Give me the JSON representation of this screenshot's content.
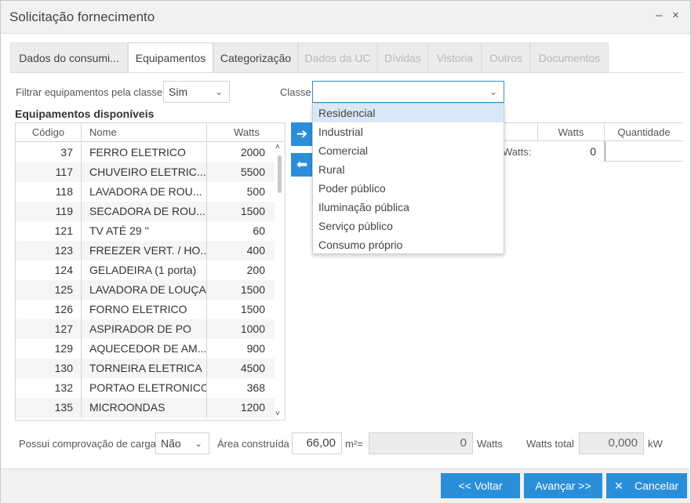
{
  "window": {
    "title": "Solicitação fornecimento",
    "minimize": "–",
    "close": "×"
  },
  "tabs": [
    {
      "label": "Dados do consumi..."
    },
    {
      "label": "Equipamentos"
    },
    {
      "label": "Categorização"
    },
    {
      "label": "Dados da UC"
    },
    {
      "label": "Dívidas"
    },
    {
      "label": "Vistoria"
    },
    {
      "label": "Outros"
    },
    {
      "label": "Documentos"
    }
  ],
  "filter": {
    "label": "Filtrar equipamentos pela classe",
    "value": "Sim",
    "chevron": "⌄"
  },
  "classe": {
    "label": "Classe",
    "value": "",
    "chevron": "⌄",
    "options": [
      "Residencial",
      "Industrial",
      "Comercial",
      "Rural",
      "Poder público",
      "Iluminação pública",
      "Serviço público",
      "Consumo próprio"
    ]
  },
  "available": {
    "title": "Equipamentos disponíveis",
    "headers": {
      "code": "Código",
      "name": "Nome",
      "watts": "Watts"
    },
    "rows": [
      {
        "code": "37",
        "name": "FERRO ELETRICO",
        "watts": "2000"
      },
      {
        "code": "117",
        "name": "CHUVEIRO ELETRIC...",
        "watts": "5500"
      },
      {
        "code": "118",
        "name": "LAVADORA DE ROU...",
        "watts": "500"
      },
      {
        "code": "119",
        "name": "SECADORA DE ROU...",
        "watts": "1500"
      },
      {
        "code": "121",
        "name": "TV ATÉ 29 ''",
        "watts": "60"
      },
      {
        "code": "123",
        "name": "FREEZER VERT. / HO...",
        "watts": "400"
      },
      {
        "code": "124",
        "name": "GELADEIRA (1 porta)",
        "watts": "200"
      },
      {
        "code": "125",
        "name": "LAVADORA DE LOUÇA",
        "watts": "1500"
      },
      {
        "code": "126",
        "name": "FORNO ELETRICO",
        "watts": "1500"
      },
      {
        "code": "127",
        "name": "ASPIRADOR DE PO",
        "watts": "1000"
      },
      {
        "code": "129",
        "name": "AQUECEDOR DE AM...",
        "watts": "900"
      },
      {
        "code": "130",
        "name": "TORNEIRA ELETRICA",
        "watts": "4500"
      },
      {
        "code": "132",
        "name": "PORTAO ELETRONICO",
        "watts": "368"
      },
      {
        "code": "135",
        "name": "MICROONDAS",
        "watts": "1200"
      }
    ]
  },
  "selected": {
    "headers": {
      "watts": "Watts",
      "qty": "Quantidade"
    },
    "total_label": "Watts:",
    "total_value": "0"
  },
  "bottom": {
    "proof_label": "Possui comprovação de carga",
    "proof_value": "Não",
    "area_label": "Área construída",
    "area_value": "66,00",
    "area_unit": "m²=",
    "area_watts": "0",
    "watts_label": "Watts",
    "watts_total_label": "Watts total",
    "watts_total_value": "0,000",
    "kw_label": "kW"
  },
  "buttons": {
    "back": "<< Voltar",
    "next": "Avançar >>",
    "cancel": "Cancelar",
    "cancel_icon": "✕"
  },
  "icons": {
    "add": "➔",
    "remove": "⬅",
    "scroll_up": "˄",
    "scroll_down": "˅"
  },
  "colors": {
    "accent": "#2a8fd8",
    "selected_option": "#d9e8f6"
  }
}
